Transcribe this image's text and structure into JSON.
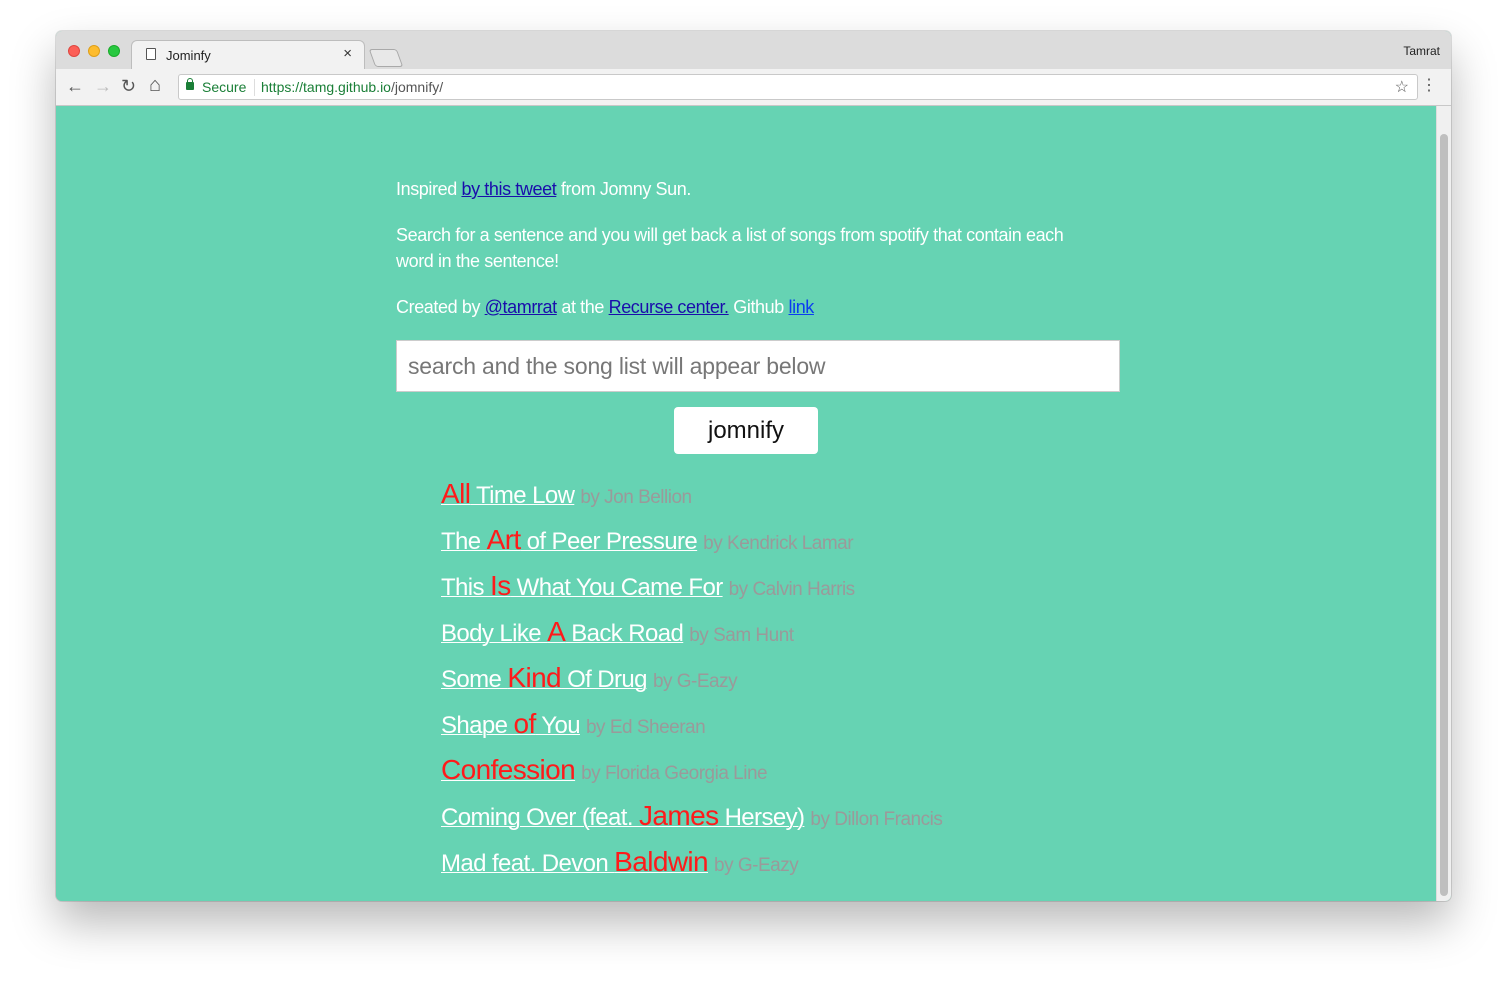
{
  "browser": {
    "tab_title": "Jominfy",
    "tab_close": "×",
    "profile_name": "Tamrat",
    "secure_label": "Secure",
    "url_host": "https://tamg.github.io",
    "url_path": "/jomnify/",
    "icons": {
      "back": "←",
      "forward": "→",
      "reload": "↻",
      "home": "⌂",
      "star": "☆",
      "menu": "⋮"
    }
  },
  "page": {
    "intro": {
      "prefix": "Inspired ",
      "tweet_link": "by this tweet",
      "suffix": " from Jomny Sun."
    },
    "description": "Search for a sentence and you will get back a list of songs from spotify that contain each word in the sentence!",
    "credits": {
      "prefix": "Created by ",
      "author_link": "@tamrrat",
      "middle": " at the ",
      "recurse_link": "Recurse center.",
      "github_prefix": " Github ",
      "github_link": "link"
    },
    "search": {
      "placeholder": "search and the song list will appear below",
      "value": ""
    },
    "button_label": "jomnify",
    "colors": {
      "background": "#66d3b3",
      "highlight": "#ff1a1a",
      "artist": "#9a9a9a"
    }
  },
  "songs": [
    {
      "before": "",
      "highlight": "All",
      "after": " Time Low",
      "artist": "by Jon Bellion"
    },
    {
      "before": "The ",
      "highlight": "Art",
      "after": " of Peer Pressure",
      "artist": "by Kendrick Lamar"
    },
    {
      "before": "This ",
      "highlight": "Is",
      "after": " What You Came For",
      "artist": "by Calvin Harris"
    },
    {
      "before": "Body Like ",
      "highlight": "A",
      "after": " Back Road",
      "artist": "by Sam Hunt"
    },
    {
      "before": "Some ",
      "highlight": "Kind",
      "after": " Of Drug",
      "artist": "by G-Eazy"
    },
    {
      "before": "Shape ",
      "highlight": "of",
      "after": " You",
      "artist": "by Ed Sheeran"
    },
    {
      "before": "",
      "highlight": "Confession",
      "after": "",
      "artist": "by Florida Georgia Line"
    },
    {
      "before": "Coming Over (feat. ",
      "highlight": "James",
      "after": " Hersey)",
      "artist": "by Dillon Francis"
    },
    {
      "before": "Mad feat. Devon ",
      "highlight": "Baldwin",
      "after": "",
      "artist": "by G-Eazy"
    }
  ]
}
